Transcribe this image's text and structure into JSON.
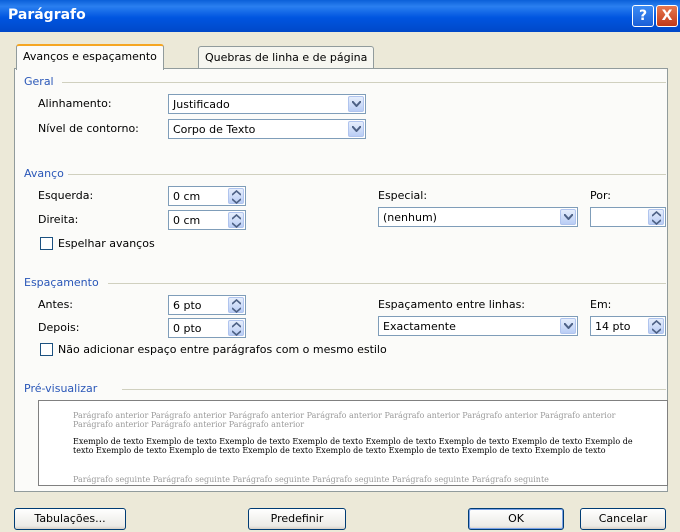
{
  "window": {
    "title": "Parágrafo",
    "help_label": "?",
    "close_label": "X"
  },
  "tabs": [
    {
      "label": "Avanços e espaçamento",
      "active": true
    },
    {
      "label": "Quebras de linha e de página",
      "active": false
    }
  ],
  "geral": {
    "heading": "Geral",
    "alignment_label": "Alinhamento:",
    "alignment_value": "Justificado",
    "outline_label": "Nível de contorno:",
    "outline_value": "Corpo de Texto"
  },
  "avanco": {
    "heading": "Avanço",
    "left_label": "Esquerda:",
    "left_value": "0 cm",
    "right_label": "Direita:",
    "right_value": "0 cm",
    "special_label": "Especial:",
    "special_value": "(nenhum)",
    "by_label": "Por:",
    "by_value": "",
    "mirror_label": "Espelhar avanços",
    "mirror_checked": false
  },
  "espacamento": {
    "heading": "Espaçamento",
    "before_label": "Antes:",
    "before_value": "6 pto",
    "after_label": "Depois:",
    "after_value": "0 pto",
    "line_spacing_label": "Espaçamento entre linhas:",
    "line_spacing_value": "Exactamente",
    "at_label": "Em:",
    "at_value": "14 pto",
    "no_space_label": "Não adicionar espaço entre parágrafos com o mesmo estilo",
    "no_space_checked": false
  },
  "preview": {
    "heading": "Pré-visualizar",
    "previous_text": "Parágrafo anterior Parágrafo anterior Parágrafo anterior Parágrafo anterior Parágrafo anterior Parágrafo anterior Parágrafo anterior Parágrafo anterior Parágrafo anterior Parágrafo anterior",
    "sample_text": "Exemplo de texto Exemplo de texto Exemplo de texto Exemplo de texto Exemplo de texto Exemplo de texto Exemplo de texto Exemplo de texto Exemplo de texto Exemplo de texto Exemplo de texto Exemplo de texto Exemplo de texto Exemplo de texto Exemplo de texto",
    "next_text": "Parágrafo seguinte Parágrafo seguinte Parágrafo seguinte Parágrafo seguinte Parágrafo seguinte Parágrafo seguinte"
  },
  "buttons": {
    "tabs_label": "Tabulações...",
    "default_label": "Predefinir",
    "ok_label": "OK",
    "cancel_label": "Cancelar"
  },
  "colors": {
    "title_bar": "#0054e3",
    "group_heading": "#2a57b8",
    "active_tab_top": "#f5a623"
  }
}
